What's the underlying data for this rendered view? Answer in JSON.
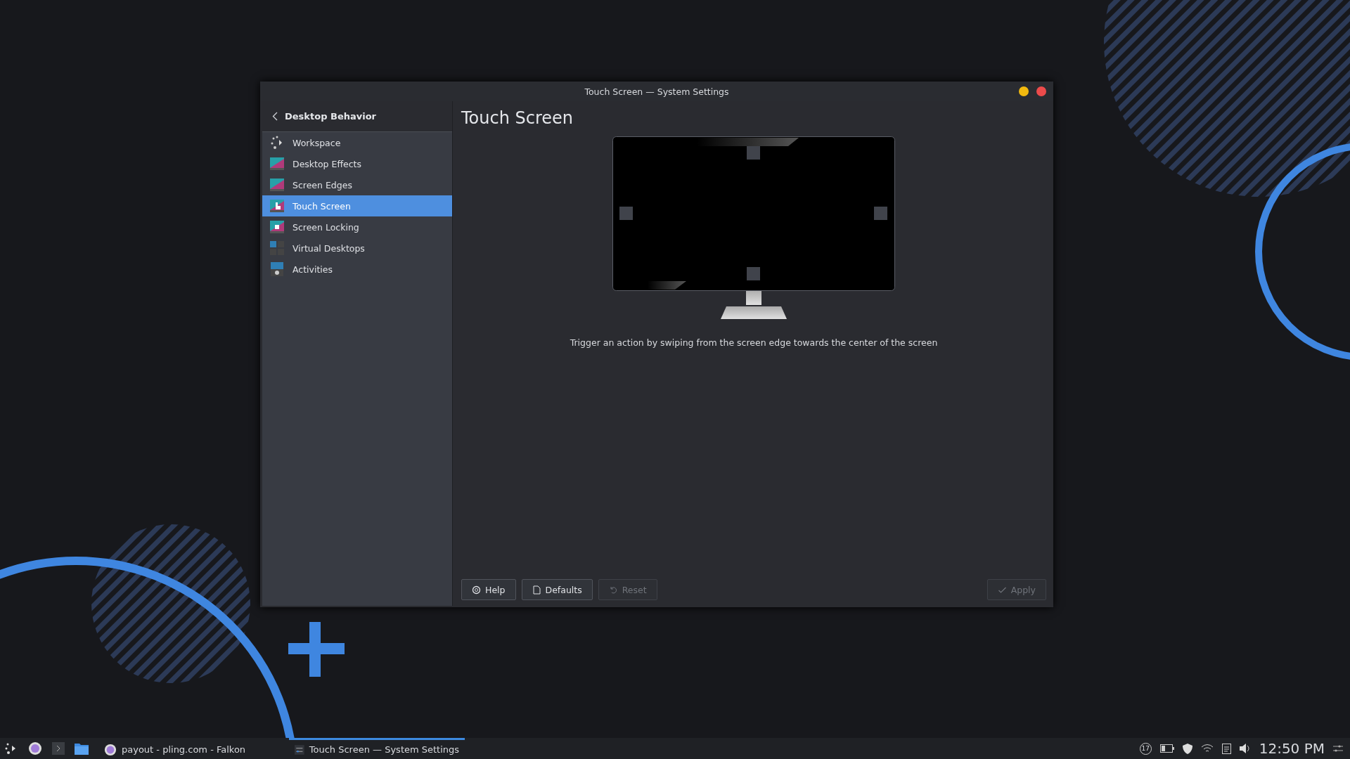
{
  "window": {
    "title": "Touch Screen — System Settings"
  },
  "sidebar": {
    "back_label": "Desktop Behavior",
    "items": [
      {
        "label": "Workspace",
        "selected": false
      },
      {
        "label": "Desktop Effects",
        "selected": false
      },
      {
        "label": "Screen Edges",
        "selected": false
      },
      {
        "label": "Touch Screen",
        "selected": true
      },
      {
        "label": "Screen Locking",
        "selected": false
      },
      {
        "label": "Virtual Desktops",
        "selected": false
      },
      {
        "label": "Activities",
        "selected": false
      }
    ]
  },
  "content": {
    "heading": "Touch Screen",
    "description": "Trigger an action by swiping from the screen edge towards the center of the screen",
    "buttons": [
      {
        "label": "Help",
        "disabled": false
      },
      {
        "label": "Defaults",
        "disabled": false
      },
      {
        "label": "Reset",
        "disabled": true
      },
      {
        "label": "Apply",
        "disabled": true
      }
    ]
  },
  "taskbar": {
    "tasks": [
      {
        "label": "payout - pling.com - Falkon",
        "selected": false
      },
      {
        "label": "Touch Screen  — System Settings",
        "selected": true
      }
    ],
    "notification_count": "17",
    "clock": "12:50 PM"
  }
}
